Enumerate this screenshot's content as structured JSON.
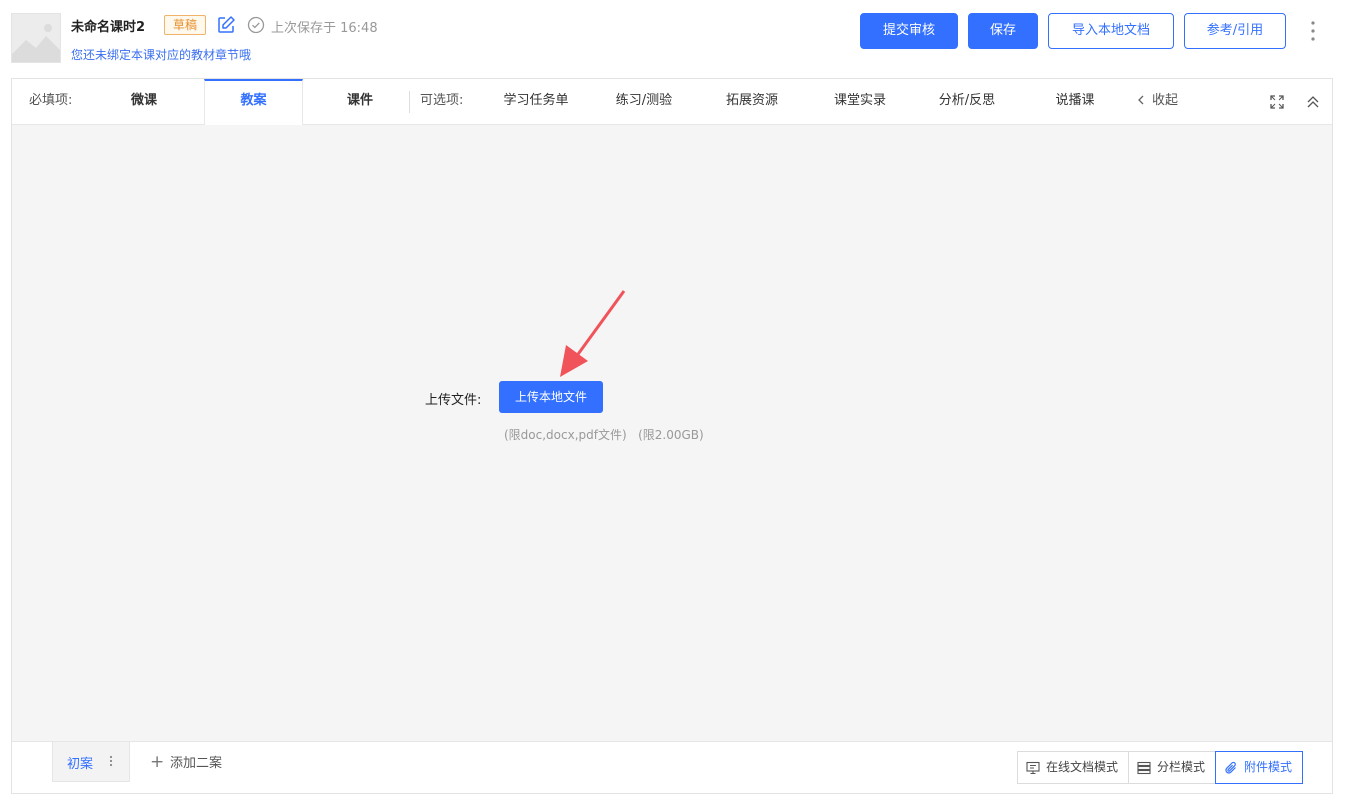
{
  "header": {
    "title": "未命名课时2",
    "status_badge": "草稿",
    "last_saved": "上次保存于 16:48",
    "subtitle_link": "您还未绑定本课对应的教材章节哦",
    "buttons": {
      "submit_review": "提交审核",
      "save": "保存",
      "import_local": "导入本地文档",
      "reference": "参考/引用"
    }
  },
  "tabs": {
    "required_label": "必填项:",
    "required": [
      "微课",
      "教案",
      "课件"
    ],
    "active_index": 1,
    "optional_label": "可选项:",
    "optional": [
      "学习任务单",
      "练习/测验",
      "拓展资源",
      "课堂实录",
      "分析/反思",
      "说播课"
    ],
    "collapse_label": "收起"
  },
  "upload": {
    "label": "上传文件:",
    "button": "上传本地文件",
    "hint": "(限doc,docx,pdf文件)   (限2.00GB)"
  },
  "bottom": {
    "draft_tab": "初案",
    "add_plan": "添加二案",
    "modes": [
      "在线文档模式",
      "分栏模式",
      "附件模式"
    ],
    "active_mode_index": 2
  },
  "colors": {
    "primary": "#3370ff",
    "badge_orange": "#e6902b",
    "annotation_arrow": "#f0535a"
  }
}
